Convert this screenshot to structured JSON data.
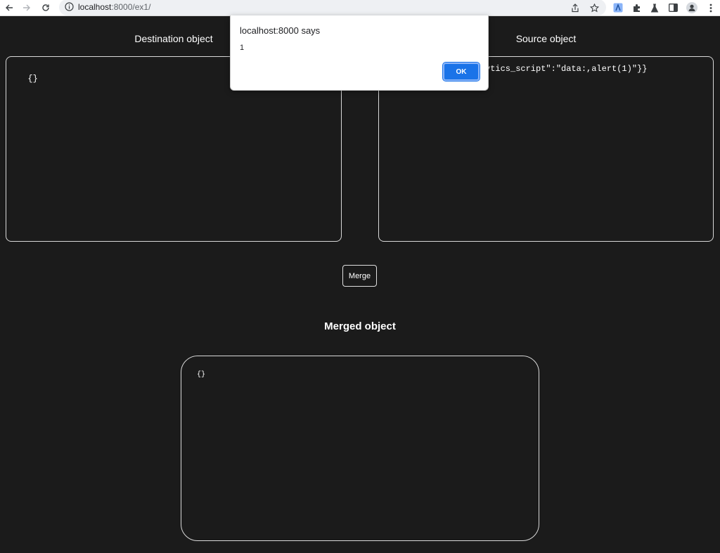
{
  "browser": {
    "url_host": "localhost",
    "url_path": ":8000/ex1/",
    "icons": [
      "back-arrow-icon",
      "forward-arrow-icon",
      "reload-icon",
      "info-icon",
      "share-icon",
      "bookmark-star-icon",
      "extension-active-icon",
      "puzzle-extensions-icon",
      "flask-labs-icon",
      "side-panel-icon",
      "profile-avatar-icon",
      "kebab-menu-icon"
    ]
  },
  "page": {
    "destination_title": "Destination object",
    "destination_value": "{}",
    "source_title": "Source object",
    "source_value_visible": "ytics_script\":\"data:,alert(1)\"}}",
    "merge_label": "Merge",
    "merged_title": "Merged object",
    "merged_value": "{}"
  },
  "dialog": {
    "title": "localhost:8000 says",
    "message": "1",
    "ok_label": "OK"
  },
  "colors": {
    "background": "#1b1b1b",
    "border": "#d9d9d9",
    "accent": "#1a73e8"
  }
}
